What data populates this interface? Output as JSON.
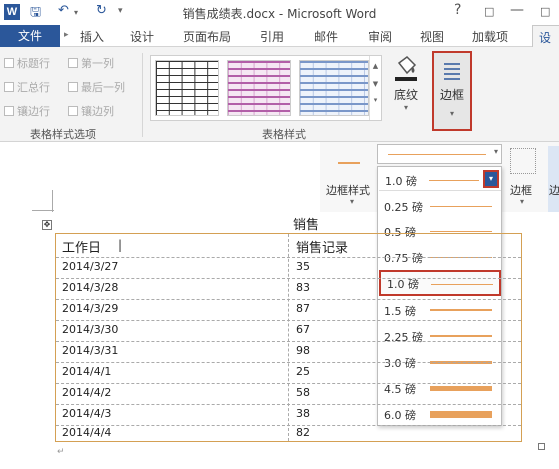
{
  "window": {
    "title": "销售成绩表.docx - Microsoft Word",
    "app_icon": "W",
    "controls": [
      "?",
      "□",
      "—",
      "□",
      "✕"
    ]
  },
  "quick_access": {
    "save": "save-icon",
    "undo": "undo-icon",
    "redo": "redo-icon"
  },
  "tabs": [
    "文件",
    "插入",
    "设计",
    "页面布局",
    "引用",
    "邮件",
    "审阅",
    "视图",
    "加载项",
    "设计"
  ],
  "ribbon": {
    "style_options": {
      "items": [
        "标题行",
        "第一列",
        "汇总行",
        "最后一列",
        "镶边行",
        "镶边列"
      ],
      "group_label": "表格样式选项"
    },
    "table_styles_label": "表格样式",
    "shading_label": "底纹",
    "borders_label": "边框",
    "border_styles_label": "边框样式",
    "pen_weight_value": "1.0 磅",
    "borders_label_2": "边框",
    "border_painter_label": "边"
  },
  "weight_options": [
    "0.25 磅",
    "0.5 磅",
    "0.75 磅",
    "1.0 磅",
    "1.5 磅",
    "2.25 磅",
    "3.0 磅",
    "4.5 磅",
    "6.0 磅"
  ],
  "selected_weight_index": 3,
  "document": {
    "heading_partial": "销售",
    "headers": [
      "工作日",
      "销售记录"
    ],
    "rows": [
      [
        "2014/3/27",
        "35"
      ],
      [
        "2014/3/28",
        "83"
      ],
      [
        "2014/3/29",
        "87"
      ],
      [
        "2014/3/30",
        "67"
      ],
      [
        "2014/3/31",
        "98"
      ],
      [
        "2014/4/1",
        "25"
      ],
      [
        "2014/4/2",
        "58"
      ],
      [
        "2014/4/3",
        "38"
      ],
      [
        "2014/4/4",
        "82"
      ]
    ]
  },
  "colors": {
    "accent": "#2b579a",
    "highlight": "#c0392b",
    "border_line": "#e8a15c",
    "table_border": "#d4a053"
  }
}
